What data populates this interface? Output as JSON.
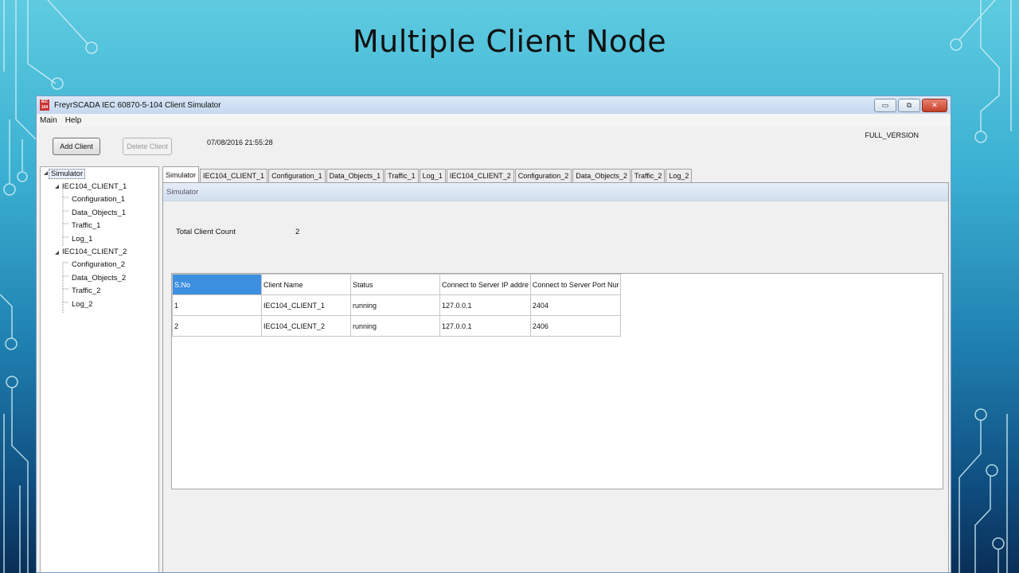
{
  "slide": {
    "title": "Multiple Client Node"
  },
  "window": {
    "title": "FreyrSCADA IEC 60870-5-104 Client Simulator",
    "app_icon_text": "IEC 104",
    "controls": {
      "minimize": "▭",
      "restore": "⧉",
      "close": "✕"
    }
  },
  "menu": [
    "Main",
    "Help"
  ],
  "toolbar": {
    "add_client": "Add Client",
    "delete_client": "Delete Client",
    "datetime": "07/08/2016 21:55:28",
    "version": "FULL_VERSION"
  },
  "tree": {
    "root": "Simulator",
    "clients": [
      {
        "name": "IEC104_CLIENT_1",
        "children": [
          "Configuration_1",
          "Data_Objects_1",
          "Traffic_1",
          "Log_1"
        ]
      },
      {
        "name": "IEC104_CLIENT_2",
        "children": [
          "Configuration_2",
          "Data_Objects_2",
          "Traffic_2",
          "Log_2"
        ]
      }
    ]
  },
  "tabs": [
    "Simulator",
    "IEC104_CLIENT_1",
    "Configuration_1",
    "Data_Objects_1",
    "Traffic_1",
    "Log_1",
    "IEC104_CLIENT_2",
    "Configuration_2",
    "Data_Objects_2",
    "Traffic_2",
    "Log_2"
  ],
  "panel": {
    "header": "Simulator",
    "total_label": "Total Client Count",
    "total_value": "2"
  },
  "table": {
    "columns": [
      "S.No",
      "Client Name",
      "Status",
      "Connect to Server IP addre",
      "Connect to Server Port Nur"
    ],
    "rows": [
      [
        "1",
        "IEC104_CLIENT_1",
        "running",
        "127.0.0.1",
        "2404"
      ],
      [
        "2",
        "IEC104_CLIENT_2",
        "running",
        "127.0.0.1",
        "2406"
      ]
    ]
  },
  "colors": {
    "accent": "#3d8fe0",
    "background_top": "#5ecbe0",
    "background_bottom": "#0a2f57"
  }
}
